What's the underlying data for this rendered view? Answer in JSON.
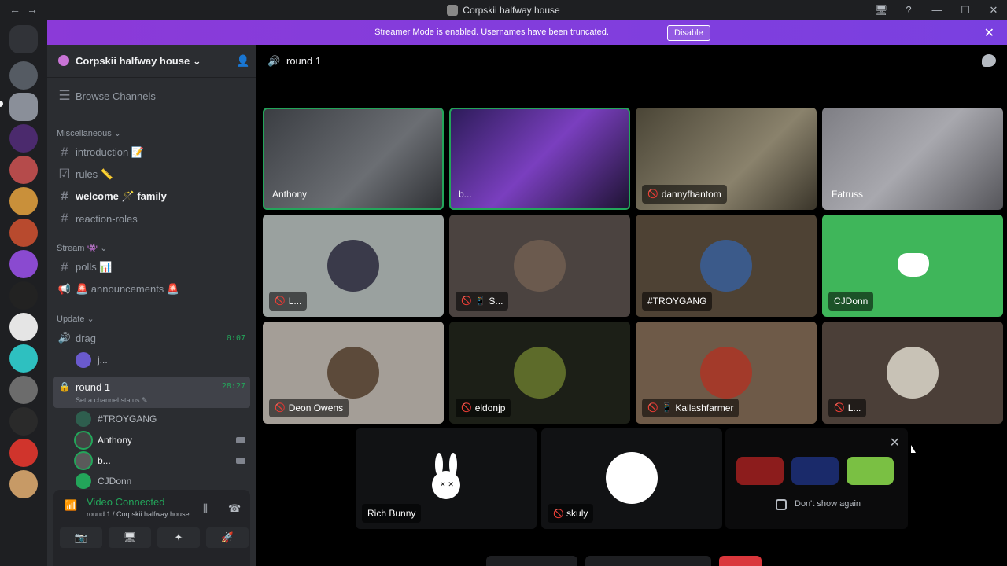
{
  "window": {
    "title": "Corpskii halfway house",
    "nav_icons": "←→",
    "controls": [
      "🖥",
      "?",
      "—",
      "☐",
      "✕"
    ]
  },
  "banner": {
    "message": "Streamer Mode is enabled. Usernames have been truncated.",
    "disable_label": "Disable",
    "close_icon": "✕"
  },
  "sidebar": {
    "guild_name": "Corpskii halfway house",
    "chevron": "⌄",
    "browse": "Browse Channels",
    "categories": [
      {
        "label": "Miscellaneous ⌄"
      },
      {
        "label": "Stream 👾 ⌄"
      },
      {
        "label": "Update ⌄"
      }
    ],
    "channels": [
      {
        "prefix": "#",
        "label": "introduction 📝"
      },
      {
        "prefix": "☑",
        "label": "rules 📏"
      },
      {
        "prefix": "#",
        "label": "welcome 🪄 family"
      },
      {
        "prefix": "#",
        "label": "reaction-roles"
      },
      {
        "prefix": "#",
        "label": "polls 📊"
      },
      {
        "prefix": "📢",
        "label": "🚨 announcements 🚨"
      },
      {
        "prefix": "🔊",
        "label": "drag",
        "time": "0:07"
      },
      {
        "prefix": "🔒",
        "label": "round 1",
        "time": "28:27",
        "status": "Set a channel status ✎"
      }
    ],
    "drag_user": "j...",
    "round_users": [
      "#TROYGANG",
      "Anthony",
      "b...",
      "CJDonn"
    ],
    "footer_user": "#TROYGANG"
  },
  "voice_panel": {
    "status": "Video Connected",
    "location": "round 1 / Corpskii halfway house",
    "signal_icon": "📶",
    "wave_icon": "⫼",
    "hangup_icon": "☎",
    "buttons": [
      "📷",
      "🖥",
      "✦",
      "🚀"
    ]
  },
  "channel_header": {
    "icon": "🔊",
    "name": "round 1"
  },
  "tiles": [
    {
      "label": "Anthony"
    },
    {
      "label": "b..."
    },
    {
      "label": "dannyfhantom"
    },
    {
      "label": "Fatruss"
    },
    {
      "label": "L..."
    },
    {
      "label": "S..."
    },
    {
      "label": "#TROYGANG"
    },
    {
      "label": "CJDonn"
    },
    {
      "label": "Deon Owens"
    },
    {
      "label": "eldonjp"
    },
    {
      "label": "Kailashfarmer"
    },
    {
      "label": "L..."
    }
  ],
  "bottom_tiles": [
    {
      "label": "Rich Bunny"
    },
    {
      "label": "skuly"
    }
  ],
  "promo": {
    "close_icon": "✕",
    "checkbox_label": "Don't show again"
  },
  "icons": {
    "mic_off": "🚫",
    "phone": "📱"
  },
  "colors": {
    "speaking": "#23a55a",
    "banner": "#8b3ad8",
    "discord": "#5865f2"
  }
}
